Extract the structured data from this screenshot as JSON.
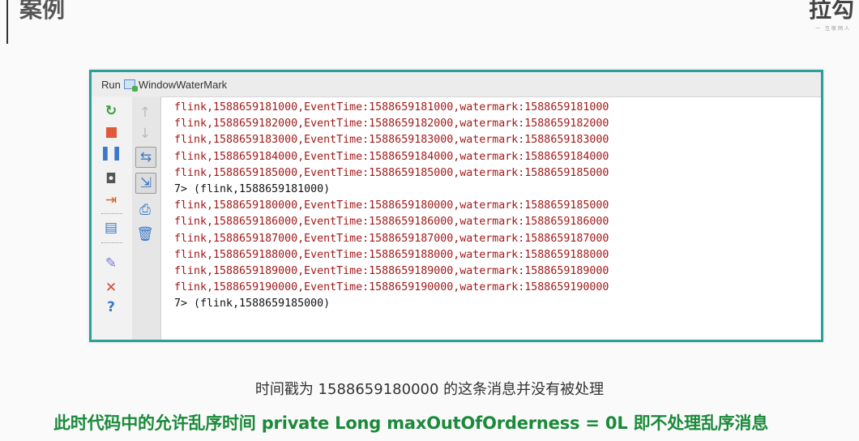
{
  "slide": {
    "title": "案例",
    "brand": "拉勾",
    "brand_sub": "一 互联网人"
  },
  "ide": {
    "run_label": "Run",
    "config_name": "WindowWaterMark",
    "toolbar_icons": [
      "rerun-icon",
      "stop-icon",
      "pause-icon",
      "dump-threads-icon",
      "exit-icon",
      "layout-icon",
      "pin-icon",
      "close-icon",
      "help-icon",
      "up-arrow-icon",
      "down-arrow-icon",
      "soft-wrap-icon",
      "scroll-to-end-icon",
      "print-icon",
      "trash-icon"
    ],
    "accent": "#2aa198",
    "console_lines": [
      {
        "text": "flink,1588659181000,EventTime:1588659181000,watermark:1588659181000",
        "kind": "red"
      },
      {
        "text": "flink,1588659182000,EventTime:1588659182000,watermark:1588659182000",
        "kind": "red"
      },
      {
        "text": "flink,1588659183000,EventTime:1588659183000,watermark:1588659183000",
        "kind": "red"
      },
      {
        "text": "flink,1588659184000,EventTime:1588659184000,watermark:1588659184000",
        "kind": "red"
      },
      {
        "text": "flink,1588659185000,EventTime:1588659185000,watermark:1588659185000",
        "kind": "red"
      },
      {
        "text": "7> (flink,1588659181000)",
        "kind": "black"
      },
      {
        "text": "flink,1588659180000,EventTime:1588659180000,watermark:1588659185000",
        "kind": "red"
      },
      {
        "text": "flink,1588659186000,EventTime:1588659186000,watermark:1588659186000",
        "kind": "red"
      },
      {
        "text": "flink,1588659187000,EventTime:1588659187000,watermark:1588659187000",
        "kind": "red"
      },
      {
        "text": "flink,1588659188000,EventTime:1588659188000,watermark:1588659188000",
        "kind": "red"
      },
      {
        "text": "flink,1588659189000,EventTime:1588659189000,watermark:1588659189000",
        "kind": "red"
      },
      {
        "text": "flink,1588659190000,EventTime:1588659190000,watermark:1588659190000",
        "kind": "red"
      },
      {
        "text": "7> (flink,1588659185000)",
        "kind": "black"
      }
    ]
  },
  "captions": {
    "line1": "时间戳为 1588659180000 的这条消息并没有被处理",
    "line2": "此时代码中的允许乱序时间 private Long maxOutOfOrderness = 0L 即不处理乱序消息"
  }
}
